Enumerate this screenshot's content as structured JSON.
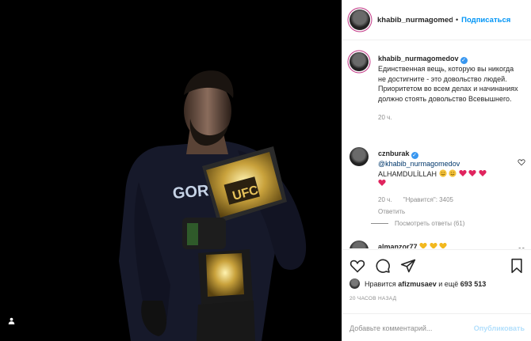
{
  "post": {
    "author": "khabib_nurmagomedov",
    "author_header": "khabib_nurmagomedov",
    "follow_label": "Подписаться",
    "header_separator": "•"
  },
  "caption": {
    "username": "khabib_nurmagomedov",
    "text": "Единственная вещь, которую вы никогда не достигните - это довольство людей. Приоритетом во всем делах и начинаниях должно стоять довольство Всевышнего.",
    "time": "20 ч."
  },
  "comments": [
    {
      "username": "cznburak",
      "mention": "@khabib_nurmagomedov",
      "text": "ALHAMDULİLLAH",
      "time": "20 ч.",
      "likes": "\"Нравится\": 3405",
      "reply_label": "Ответить",
      "view_replies": "Посмотреть ответы (61)"
    },
    {
      "username": "almanzor77"
    }
  ],
  "actions": {
    "liked_by_prefix": "Нравится",
    "liked_by_user": "afizmusaev",
    "liked_by_suffix": "и ещё",
    "likes_count": "693 513",
    "timestamp": "20 ЧАСОВ НАЗАД"
  },
  "comment_box": {
    "placeholder": "Добавьте комментарий...",
    "post_label": "Опубликовать"
  },
  "icons": {
    "like": "heart-icon",
    "comment": "comment-icon",
    "share": "share-icon",
    "save": "bookmark-icon",
    "tag": "user-tag-icon",
    "verified": "verified-badge-icon"
  },
  "colors": {
    "link_blue": "#0095f6",
    "verified_blue": "#3897f0",
    "muted": "#8e8e8e",
    "emoji_heart": "#e0245e"
  }
}
